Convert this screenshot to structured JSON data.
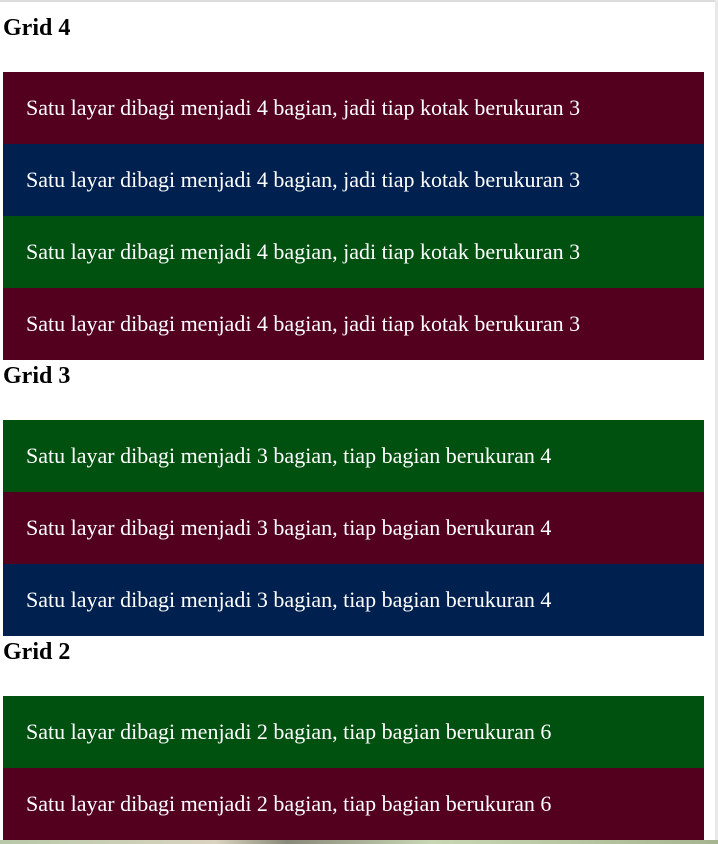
{
  "colors": {
    "maroon": "#52001e",
    "navy": "#002050",
    "green": "#005010"
  },
  "sections": [
    {
      "title": "Grid 4",
      "boxes": [
        {
          "text": "Satu layar dibagi menjadi 4 bagian, jadi tiap kotak berukuran 3",
          "color": "#52001e"
        },
        {
          "text": "Satu layar dibagi menjadi 4 bagian, jadi tiap kotak berukuran 3",
          "color": "#002050"
        },
        {
          "text": "Satu layar dibagi menjadi 4 bagian, jadi tiap kotak berukuran 3",
          "color": "#005010"
        },
        {
          "text": "Satu layar dibagi menjadi 4 bagian, jadi tiap kotak berukuran 3",
          "color": "#52001e"
        }
      ]
    },
    {
      "title": "Grid 3",
      "boxes": [
        {
          "text": "Satu layar dibagi menjadi 3 bagian, tiap bagian berukuran 4",
          "color": "#005010"
        },
        {
          "text": "Satu layar dibagi menjadi 3 bagian, tiap bagian berukuran 4",
          "color": "#52001e"
        },
        {
          "text": "Satu layar dibagi menjadi 3 bagian, tiap bagian berukuran 4",
          "color": "#002050"
        }
      ]
    },
    {
      "title": "Grid 2",
      "boxes": [
        {
          "text": "Satu layar dibagi menjadi 2 bagian, tiap bagian berukuran 6",
          "color": "#005010"
        },
        {
          "text": "Satu layar dibagi menjadi 2 bagian, tiap bagian berukuran 6",
          "color": "#52001e"
        }
      ]
    }
  ]
}
